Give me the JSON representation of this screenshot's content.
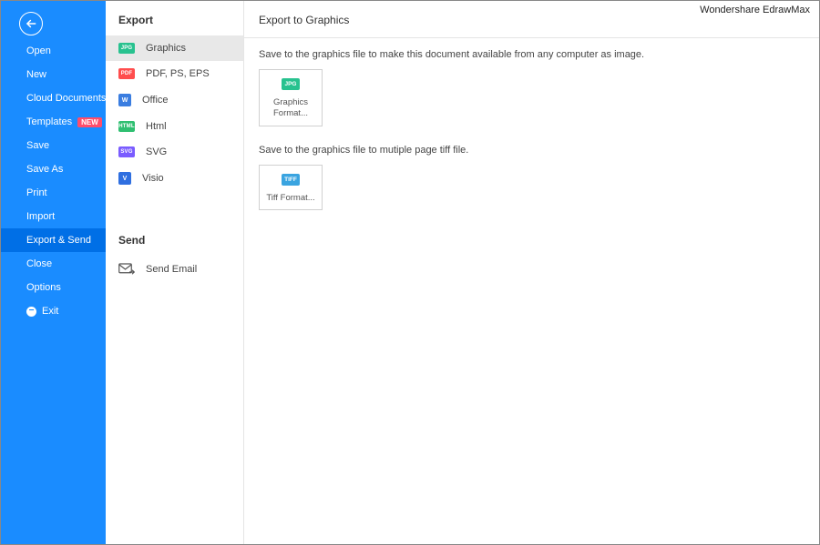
{
  "app_title": "Wondershare EdrawMax",
  "sidebar": {
    "items": [
      {
        "label": "Open"
      },
      {
        "label": "New"
      },
      {
        "label": "Cloud Documents"
      },
      {
        "label": "Templates",
        "badge": "NEW"
      },
      {
        "label": "Save"
      },
      {
        "label": "Save As"
      },
      {
        "label": "Print"
      },
      {
        "label": "Import"
      },
      {
        "label": "Export & Send",
        "active": true
      },
      {
        "label": "Close"
      },
      {
        "label": "Options"
      },
      {
        "label": "Exit",
        "exit": true
      }
    ]
  },
  "middle": {
    "section1_title": "Export",
    "section2_title": "Send",
    "formats": [
      {
        "label": "Graphics",
        "icon_text": "JPG",
        "icon_class": "c-jpg",
        "active": true,
        "square": false
      },
      {
        "label": "PDF, PS, EPS",
        "icon_text": "PDF",
        "icon_class": "c-pdf",
        "square": false
      },
      {
        "label": "Office",
        "icon_text": "W",
        "icon_class": "c-word",
        "square": true
      },
      {
        "label": "Html",
        "icon_text": "HTML",
        "icon_class": "c-html",
        "square": false
      },
      {
        "label": "SVG",
        "icon_text": "SVG",
        "icon_class": "c-svg",
        "square": false
      },
      {
        "label": "Visio",
        "icon_text": "V",
        "icon_class": "c-visio",
        "square": true
      }
    ],
    "send_item_label": "Send Email"
  },
  "right": {
    "header": "Export to Graphics",
    "desc1": "Save to the graphics file to make this document available from any computer as image.",
    "desc2": "Save to the graphics file to mutiple page tiff file.",
    "tile1": {
      "icon_text": "JPG",
      "icon_class": "c-jpg",
      "label": "Graphics Format..."
    },
    "tile2": {
      "icon_text": "TIFF",
      "icon_class": "c-tiff",
      "label": "Tiff Format..."
    }
  }
}
